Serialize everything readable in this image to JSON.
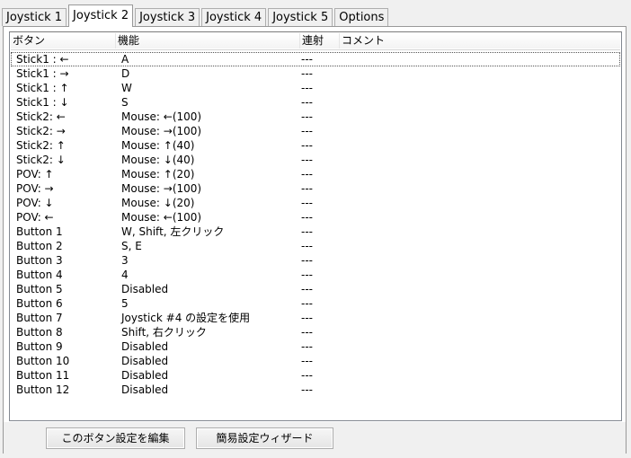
{
  "tabs": [
    {
      "label": "Joystick 1"
    },
    {
      "label": "Joystick 2"
    },
    {
      "label": "Joystick 3"
    },
    {
      "label": "Joystick 4"
    },
    {
      "label": "Joystick 5"
    },
    {
      "label": "Options"
    }
  ],
  "active_tab": "Joystick 2",
  "columns": {
    "button": "ボタン",
    "function": "機能",
    "rapid": "連射",
    "comment": "コメント"
  },
  "rows": [
    {
      "button": "Stick1 : ←",
      "function": "A",
      "rapid": "---",
      "comment": ""
    },
    {
      "button": "Stick1 : →",
      "function": "D",
      "rapid": "---",
      "comment": ""
    },
    {
      "button": "Stick1 : ↑",
      "function": "W",
      "rapid": "---",
      "comment": ""
    },
    {
      "button": "Stick1 : ↓",
      "function": "S",
      "rapid": "---",
      "comment": ""
    },
    {
      "button": "Stick2: ←",
      "function": "Mouse: ←(100)",
      "rapid": "---",
      "comment": ""
    },
    {
      "button": "Stick2: →",
      "function": "Mouse: →(100)",
      "rapid": "---",
      "comment": ""
    },
    {
      "button": "Stick2: ↑",
      "function": "Mouse: ↑(40)",
      "rapid": "---",
      "comment": ""
    },
    {
      "button": "Stick2: ↓",
      "function": "Mouse: ↓(40)",
      "rapid": "---",
      "comment": ""
    },
    {
      "button": "POV: ↑",
      "function": "Mouse: ↑(20)",
      "rapid": "---",
      "comment": ""
    },
    {
      "button": "POV: →",
      "function": "Mouse: →(100)",
      "rapid": "---",
      "comment": ""
    },
    {
      "button": "POV: ↓",
      "function": "Mouse: ↓(20)",
      "rapid": "---",
      "comment": ""
    },
    {
      "button": "POV: ←",
      "function": "Mouse: ←(100)",
      "rapid": "---",
      "comment": ""
    },
    {
      "button": "Button 1",
      "function": "W, Shift, 左クリック",
      "rapid": "---",
      "comment": ""
    },
    {
      "button": "Button 2",
      "function": "S, E",
      "rapid": "---",
      "comment": ""
    },
    {
      "button": "Button 3",
      "function": "3",
      "rapid": "---",
      "comment": ""
    },
    {
      "button": "Button 4",
      "function": "4",
      "rapid": "---",
      "comment": ""
    },
    {
      "button": "Button 5",
      "function": "Disabled",
      "rapid": "---",
      "comment": ""
    },
    {
      "button": "Button 6",
      "function": "5",
      "rapid": "---",
      "comment": ""
    },
    {
      "button": "Button 7",
      "function": "Joystick #4 の設定を使用",
      "rapid": "---",
      "comment": ""
    },
    {
      "button": "Button 8",
      "function": "Shift, 右クリック",
      "rapid": "---",
      "comment": ""
    },
    {
      "button": "Button 9",
      "function": "Disabled",
      "rapid": "---",
      "comment": ""
    },
    {
      "button": "Button 10",
      "function": "Disabled",
      "rapid": "---",
      "comment": ""
    },
    {
      "button": "Button 11",
      "function": "Disabled",
      "rapid": "---",
      "comment": ""
    },
    {
      "button": "Button 12",
      "function": "Disabled",
      "rapid": "---",
      "comment": ""
    }
  ],
  "buttons": {
    "edit": "このボタン設定を編集",
    "wizard": "簡易設定ウィザード"
  }
}
